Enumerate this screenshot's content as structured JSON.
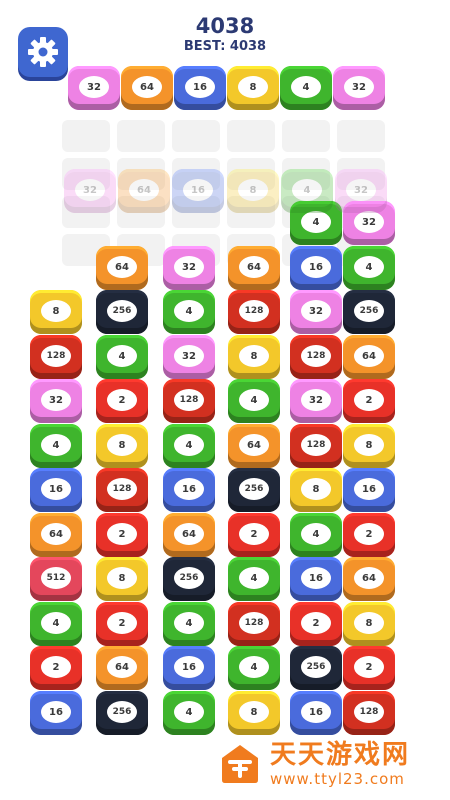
{
  "score": "4038",
  "best": "BEST: 4038",
  "colors": {
    "2": "#e83128",
    "4": "#3fb52d",
    "8": "#f3c82a",
    "16": "#4a6bdc",
    "32": "#ee82e4",
    "64": "#f4932a",
    "128": "#d23020",
    "256": "#1f2738",
    "512": "#e4475c"
  },
  "next_row": [
    "32",
    "64",
    "16",
    "8",
    "4",
    "32"
  ],
  "ghost_row": [
    "32",
    "64",
    "16",
    "8",
    "4",
    "32"
  ],
  "board": [
    [
      "",
      "",
      "",
      "",
      "4",
      "32"
    ],
    [
      "",
      "64",
      "32",
      "64",
      "16",
      "4"
    ],
    [
      "8",
      "256",
      "4",
      "128",
      "32",
      "256"
    ],
    [
      "128",
      "4",
      "32",
      "8",
      "128",
      "64"
    ],
    [
      "32",
      "2",
      "128",
      "4",
      "32",
      "2"
    ],
    [
      "4",
      "8",
      "4",
      "64",
      "128",
      "8"
    ],
    [
      "16",
      "128",
      "16",
      "256",
      "8",
      "16"
    ],
    [
      "64",
      "2",
      "64",
      "2",
      "4",
      "2"
    ],
    [
      "512",
      "8",
      "256",
      "4",
      "16",
      "64"
    ],
    [
      "4",
      "2",
      "4",
      "128",
      "2",
      "8"
    ],
    [
      "2",
      "64",
      "16",
      "4",
      "256",
      "2"
    ],
    [
      "16",
      "256",
      "4",
      "8",
      "16",
      "128"
    ]
  ],
  "watermark": {
    "title": "天天游戏网",
    "url": "www.ttyl23.com"
  }
}
